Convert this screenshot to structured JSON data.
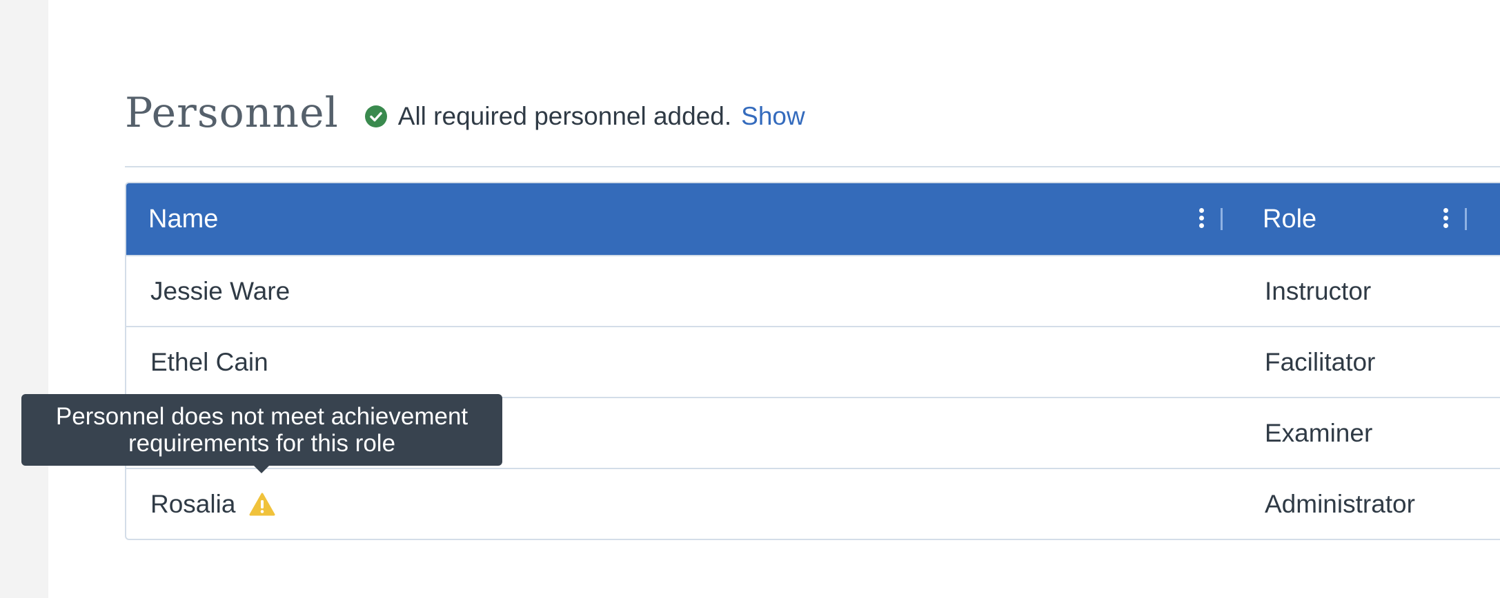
{
  "header": {
    "title": "Personnel",
    "status_text": "All required personnel added.",
    "show_link": "Show"
  },
  "table": {
    "columns": [
      "Name",
      "Role"
    ],
    "rows": [
      {
        "name": "Jessie Ware",
        "role": "Instructor"
      },
      {
        "name": "Ethel Cain",
        "role": "Facilitator"
      },
      {
        "name": "",
        "role": "Examiner"
      },
      {
        "name": "Rosalia",
        "role": "Administrator"
      }
    ]
  },
  "tooltip": {
    "line1": "Personnel does not meet achievement",
    "line2": "requirements for this role"
  },
  "colors": {
    "accent": "#346bba",
    "success": "#3a8a4e",
    "warning": "#f0c23b",
    "link": "#346bbd",
    "tooltip_bg": "#38434f"
  },
  "icons": {
    "status": "check-circle-icon",
    "warning": "warning-triangle-icon",
    "column_menu": "kebab-menu-icon"
  }
}
